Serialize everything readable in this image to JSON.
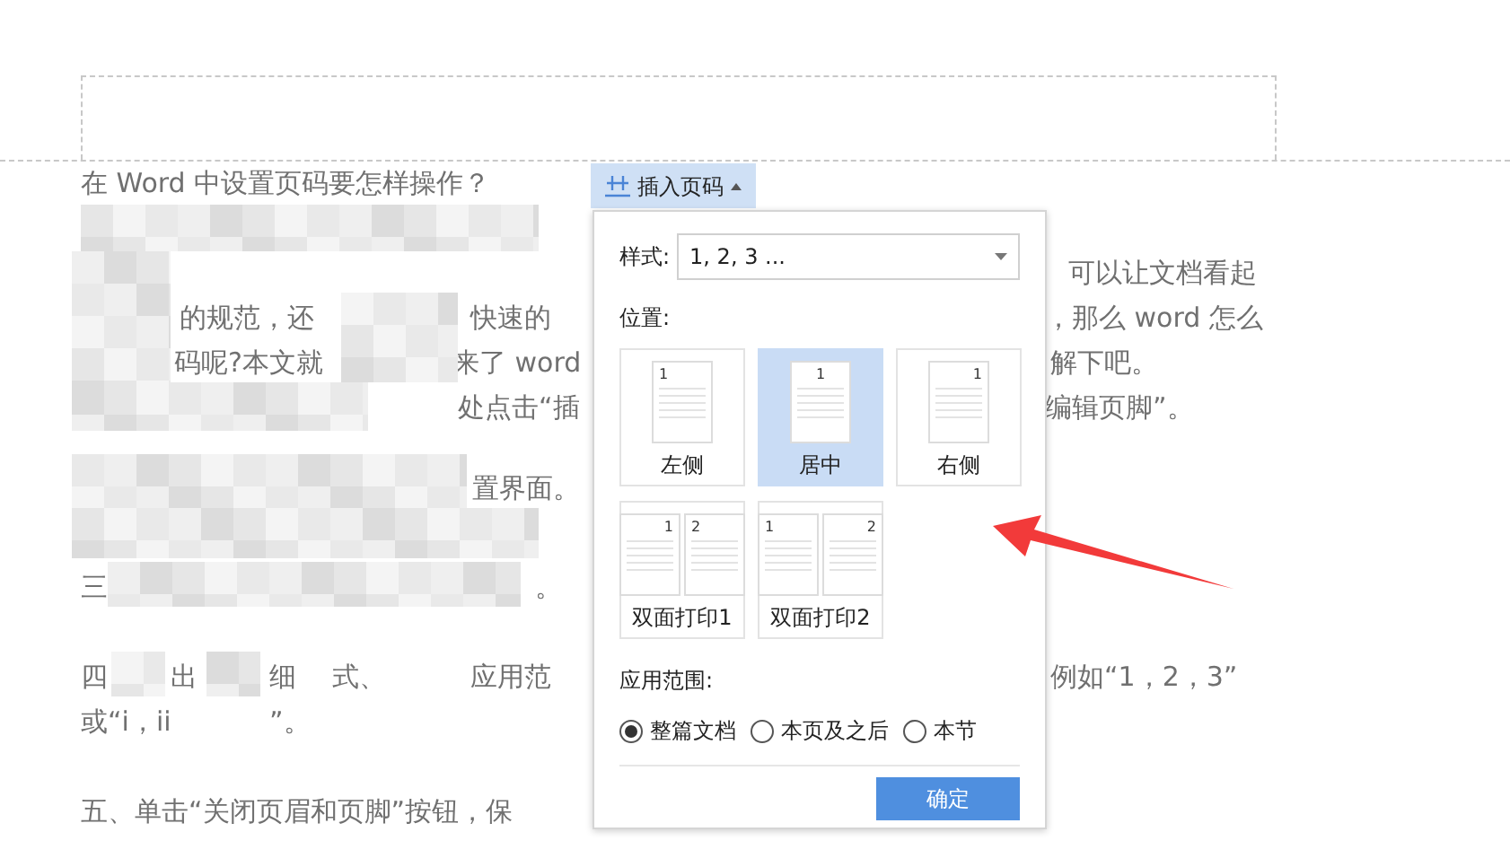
{
  "document": {
    "lines": [
      {
        "fragments": [
          "在 Word 中设置页码要怎样操作？"
        ]
      },
      {
        "fragments": [
          "可以让文档看起"
        ]
      },
      {
        "fragments": [
          "的规范，还",
          "快速的",
          "，那么 word 怎么"
        ]
      },
      {
        "fragments": [
          "码呢?本文就",
          "来了 word",
          "解下吧。"
        ]
      },
      {
        "fragments": [
          "处点击“插",
          "编辑页脚”。"
        ]
      },
      {
        "fragments": [
          "置界面。"
        ]
      },
      {
        "fragments": [
          "三",
          "。"
        ]
      },
      {
        "fragments": [
          "四",
          "出",
          "细",
          "式、",
          "应用范",
          "例如“1，2，3”"
        ]
      },
      {
        "fragments": [
          "或“i，ii",
          "”。"
        ]
      },
      {
        "fragments": [
          "五、单击“关闭页眉和页脚”按钮，保"
        ]
      }
    ]
  },
  "popup": {
    "button": "插入页码",
    "style_label": "样式:",
    "style_value": "1, 2, 3 ...",
    "position_label": "位置:",
    "tiles": [
      {
        "kind": "left",
        "label": "左侧",
        "numbers": [
          "1"
        ],
        "selected": false
      },
      {
        "kind": "center",
        "label": "居中",
        "numbers": [
          "1"
        ],
        "selected": true
      },
      {
        "kind": "right",
        "label": "右侧",
        "numbers": [
          "1"
        ],
        "selected": false
      },
      {
        "kind": "duplex1",
        "label": "双面打印1",
        "numbers": [
          "1",
          "2"
        ],
        "selected": false
      },
      {
        "kind": "duplex2",
        "label": "双面打印2",
        "numbers": [
          "1",
          "2"
        ],
        "selected": false
      }
    ],
    "scope_label": "应用范围:",
    "scopes": [
      {
        "label": "整篇文档",
        "selected": true
      },
      {
        "label": "本页及之后",
        "selected": false
      },
      {
        "label": "本节",
        "selected": false
      }
    ],
    "ok": "确定"
  }
}
